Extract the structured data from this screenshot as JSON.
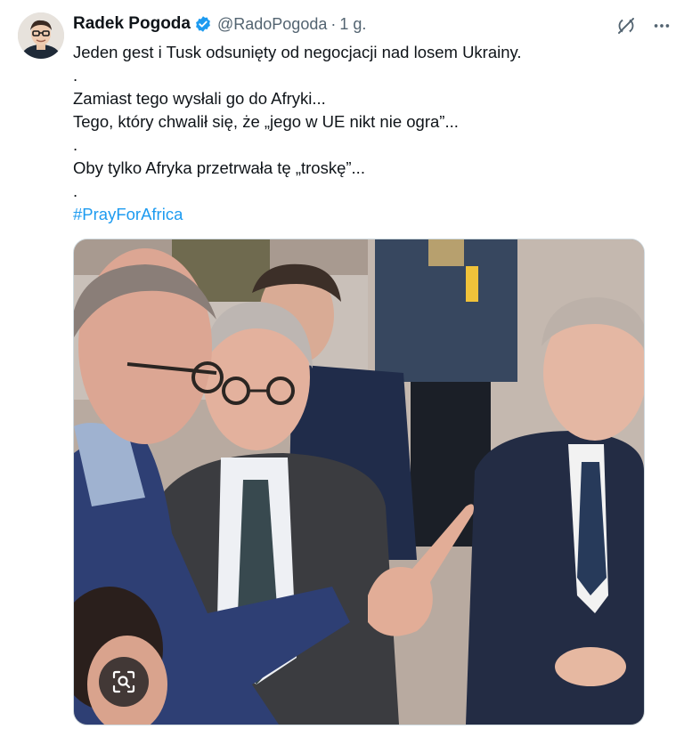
{
  "author": {
    "name": "Radek Pogoda",
    "handle": "@RadoPogoda",
    "separator": "·",
    "time": "1 g."
  },
  "tweet": {
    "lines": [
      "Jeden gest i Tusk odsunięty od negocjacji nad losem Ukrainy.",
      ".",
      "Zamiast tego wysłali go do Afryki...",
      "Tego, który chwalił się, że „jego w UE nikt nie ogra”...",
      ".",
      "Oby tylko Afryka przetrwała tę „troskę”...",
      "."
    ],
    "hashtag": "#PrayForAfrica"
  },
  "colors": {
    "link": "#1d9bf0",
    "verified": "#1d9bf0",
    "secondary_text": "#536471"
  },
  "icons": {
    "verified": "verified-badge-icon",
    "grok": "grok-icon",
    "more": "more-icon",
    "lens": "image-search-icon"
  }
}
